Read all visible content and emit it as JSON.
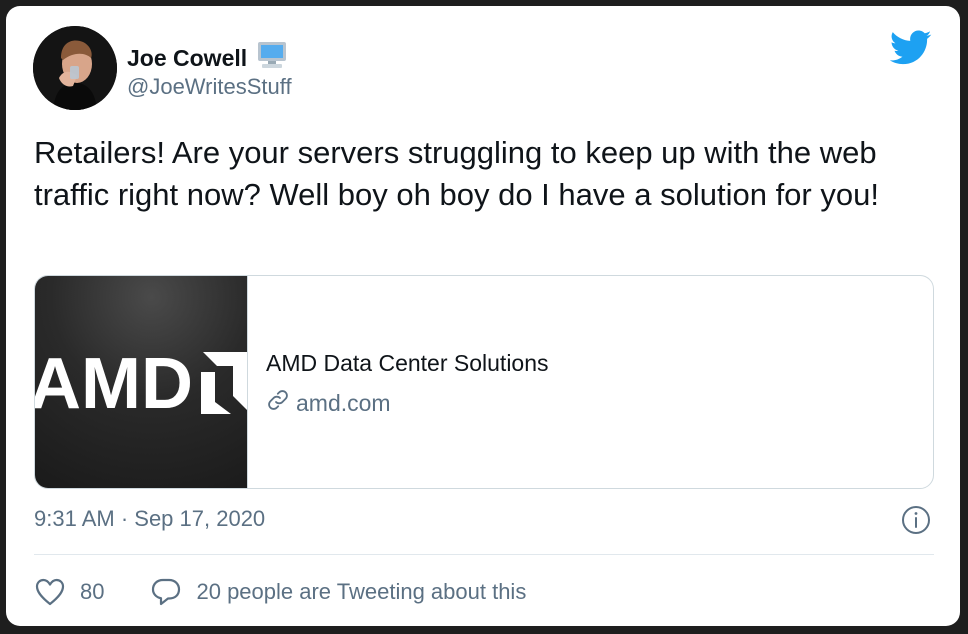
{
  "user": {
    "display_name": "Joe Cowell",
    "display_name_emoji": "💻",
    "handle": "@JoeWritesStuff"
  },
  "tweet": {
    "text": "Retailers! Are your servers struggling to keep up with the web traffic right now? Well boy oh boy do I have a solution for you!",
    "timestamp": "9:31 AM · Sep 17, 2020"
  },
  "link_card": {
    "logo_text": "AMD",
    "title": "AMD Data Center Solutions",
    "domain": "amd.com"
  },
  "actions": {
    "like_count": "80",
    "conversation_text": "20 people are Tweeting about this"
  },
  "icons": {
    "brand": "twitter-bird-icon",
    "info": "info-icon",
    "like": "heart-icon",
    "reply": "speech-bubble-icon",
    "link": "link-icon"
  },
  "colors": {
    "twitter_blue": "#1da1f2",
    "secondary_text": "#5b7083",
    "primary_text": "#0f1419"
  }
}
